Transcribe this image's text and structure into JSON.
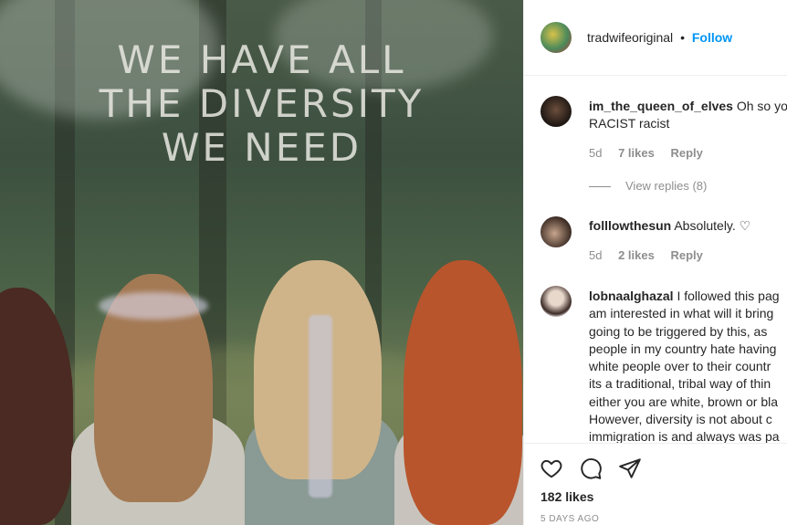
{
  "image": {
    "overlay_lines": [
      "WE HAVE ALL",
      "THE DIVERSITY",
      "WE NEED"
    ]
  },
  "header": {
    "username": "tradwifeoriginal",
    "separator": "•",
    "follow_label": "Follow"
  },
  "comments": [
    {
      "username": "im_the_queen_of_elves",
      "lines": [
        "Oh so you",
        "RACIST racist"
      ],
      "time": "5d",
      "likes": "7 likes",
      "reply_label": "Reply",
      "view_replies": "View replies (8)"
    },
    {
      "username": "folllowthesun",
      "lines": [
        "Absolutely. ♡"
      ],
      "time": "5d",
      "likes": "2 likes",
      "reply_label": "Reply"
    },
    {
      "username": "lobnaalghazal",
      "lines": [
        "I followed this pag",
        "am interested in what will it bring",
        "going to be triggered by this, as",
        "people in my country hate having",
        "white people over to their countr",
        "its a traditional, tribal way of thin",
        "either you are white, brown or bla",
        "However, diversity is not about c",
        "immigration is and always was pa"
      ]
    }
  ],
  "footer": {
    "likes": "182 likes",
    "date": "5 DAYS AGO"
  },
  "colors": {
    "link_blue": "#0095f6",
    "text": "#262626",
    "muted": "#8e8e8e"
  },
  "icons": [
    "heart-icon",
    "comment-icon",
    "share-icon"
  ]
}
